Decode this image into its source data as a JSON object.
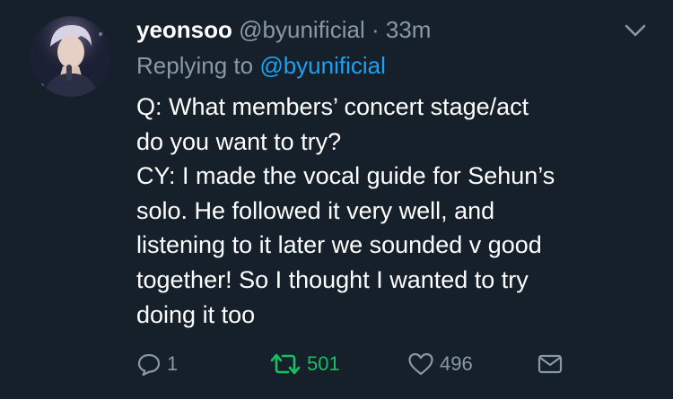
{
  "tweet": {
    "display_name": "yeonsoo",
    "handle": "@byunificial",
    "separator": "·",
    "time": "33m",
    "replying_prefix": "Replying to",
    "replying_to": "@byunificial",
    "body_lines": [
      "Q: What members’ concert stage/act",
      "do you want to try?",
      "CY: I made the vocal guide for Sehun’s",
      "solo. He followed it very well, and",
      "listening to it later we sounded v good",
      "together! So I thought I wanted to try",
      "doing it too"
    ],
    "actions": {
      "reply_count": "1",
      "retweet_count": "501",
      "like_count": "496"
    }
  },
  "colors": {
    "background": "#15202b",
    "secondary_text": "#8899a6",
    "link": "#1da1f2",
    "retweet_active": "#17bf63"
  },
  "icons": [
    "chevron-down-icon",
    "reply-icon",
    "retweet-icon",
    "heart-icon",
    "mail-icon"
  ]
}
